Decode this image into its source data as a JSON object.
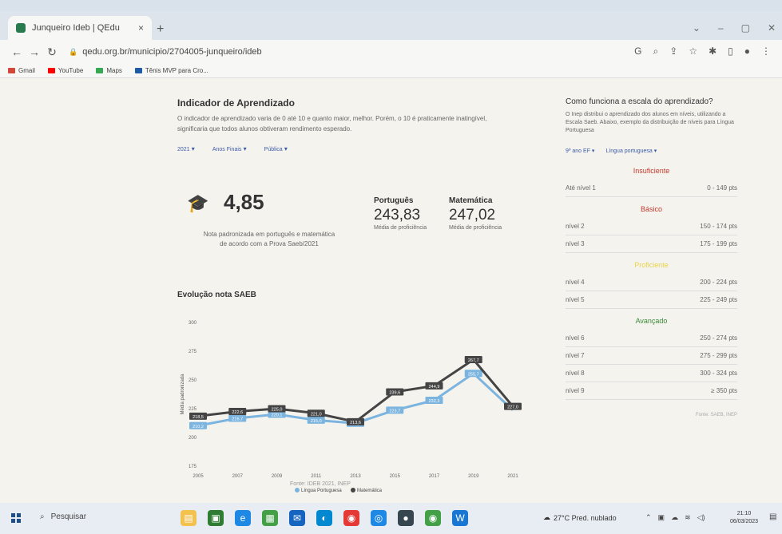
{
  "browser": {
    "tab_title": "Junqueiro Ideb | QEdu",
    "tab_close": "×",
    "new_tab": "+",
    "url": "qedu.org.br/municipio/2704005-junqueiro/ideb",
    "bookmarks": [
      {
        "label": "Gmail",
        "color": "#d44638"
      },
      {
        "label": "YouTube",
        "color": "#ff0000"
      },
      {
        "label": "Maps",
        "color": "#34a853"
      },
      {
        "label": "Tênis MVP para Cro...",
        "color": "#1e5aa8"
      }
    ]
  },
  "indicator": {
    "title": "Indicador de Aprendizado",
    "description": "O indicador de aprendizado varia de 0 até 10 e quanto maior, melhor. Porém, o 10 é praticamente inatingível, significaria que todos alunos obtiveram rendimento esperado.",
    "filters": [
      "2021",
      "Anos Finais",
      "Pública"
    ],
    "score": "4,85",
    "score_note": "Nota padronizada em português e matemática de acordo com a Prova Saeb/2021",
    "portugues": {
      "label": "Português",
      "value": "243,83",
      "caption": "Média de proficiência"
    },
    "matematica": {
      "label": "Matemática",
      "value": "247,02",
      "caption": "Média de proficiência"
    }
  },
  "chart_title": "Evolução nota SAEB",
  "chart_data": {
    "type": "line",
    "ylabel": "Média padronizada",
    "x": [
      "2005",
      "2007",
      "2009",
      "2011",
      "2013",
      "2015",
      "2017",
      "2019",
      "2021"
    ],
    "yticks": [
      "300",
      "275",
      "250",
      "225",
      "200",
      "175"
    ],
    "ylim": [
      175,
      300
    ],
    "series": [
      {
        "name": "Língua Portuguesa",
        "color": "#7ab4df",
        "values": [
          210.2,
          216.7,
          220.1,
          215.0,
          212.3,
          223.7,
          232.3,
          255.7,
          223.8
        ]
      },
      {
        "name": "Matemática",
        "color": "#444444",
        "values": [
          218.5,
          222.6,
          225.0,
          221.0,
          213.6,
          239.6,
          244.9,
          267.7,
          227.0
        ]
      }
    ],
    "labels_pt": [
      "210,2",
      "216,7",
      "220,1",
      "215,0",
      "212,3",
      "223,7",
      "232,3",
      "255,7",
      ""
    ],
    "labels_mt": [
      "218,5",
      "222,6",
      "225,0",
      "221,0",
      "213,6",
      "239,6",
      "244,9",
      "267,7",
      "227,0"
    ],
    "legend": "bottom"
  },
  "source": "Fonte: IDEB 2021, INEP",
  "scale": {
    "title": "Como funciona a escala do aprendizado?",
    "description": "O Inep distribui o aprendizado dos alunos em níveis, utilizando a Escala Saeb. Abaixo, exemplo da distribuição de níveis para Língua Portuguesa",
    "filters": [
      "9º ano EF",
      "Língua portuguesa"
    ],
    "groups": [
      {
        "name": "Insuficiente",
        "color": "#c0392b",
        "rows": [
          [
            "Até nível 1",
            "0 - 149 pts"
          ]
        ]
      },
      {
        "name": "Básico",
        "color": "#c0392b",
        "rows": [
          [
            "nível 2",
            "150 - 174 pts"
          ],
          [
            "nível 3",
            "175 - 199 pts"
          ]
        ]
      },
      {
        "name": "Proficiente",
        "color": "#e8d44a",
        "rows": [
          [
            "nível 4",
            "200 - 224 pts"
          ],
          [
            "nível 5",
            "225 - 249 pts"
          ]
        ]
      },
      {
        "name": "Avançado",
        "color": "#3a8a3a",
        "rows": [
          [
            "nível 6",
            "250 - 274 pts"
          ],
          [
            "nível 7",
            "275 - 299 pts"
          ],
          [
            "nível 8",
            "300 - 324 pts"
          ],
          [
            "nível 9",
            "≥ 350 pts"
          ]
        ]
      }
    ],
    "source": "Fonte: SAEB, INEP"
  },
  "taskbar": {
    "search": "Pesquisar",
    "weather": "27°C  Pred. nublado",
    "time": "21:10",
    "date": "06/03/2023"
  }
}
